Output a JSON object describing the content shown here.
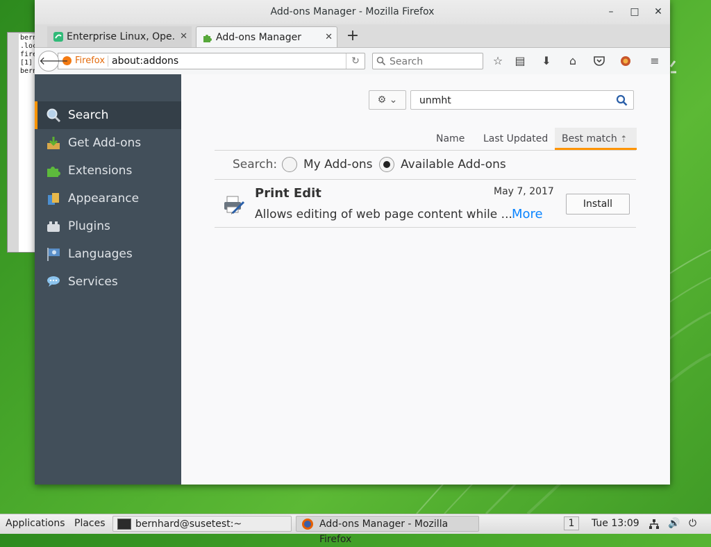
{
  "window": {
    "title": "Add-ons Manager - Mozilla Firefox",
    "minimize": "–",
    "maximize": "□",
    "close": "✕"
  },
  "background_terminal": {
    "lines": [
      "bern",
      ".loc",
      "fire",
      "[1]",
      "bern"
    ]
  },
  "tabs": [
    {
      "label": "Enterprise Linux, Ope...",
      "close": "✕"
    },
    {
      "label": "Add-ons Manager",
      "close": "✕"
    }
  ],
  "newtab": "+",
  "navbar": {
    "identity_label": "Firefox",
    "url": "about:addons",
    "search_placeholder": "Search"
  },
  "sidebar": {
    "items": [
      {
        "label": "Search"
      },
      {
        "label": "Get Add-ons"
      },
      {
        "label": "Extensions"
      },
      {
        "label": "Appearance"
      },
      {
        "label": "Plugins"
      },
      {
        "label": "Languages"
      },
      {
        "label": "Services"
      }
    ]
  },
  "addons_search": {
    "value": "unmht"
  },
  "sorters": {
    "name": "Name",
    "last_updated": "Last Updated",
    "best_match": "Best match"
  },
  "scope": {
    "label": "Search:",
    "my_addons": "My Add-ons",
    "available_addons": "Available Add-ons",
    "selected": "Available Add-ons"
  },
  "results": [
    {
      "name": "Print Edit",
      "date": "May 7, 2017",
      "description": "Allows editing of web page content while ...",
      "more": "More",
      "install": "Install"
    }
  ],
  "taskbar": {
    "applications": "Applications",
    "places": "Places",
    "terminal_task": "bernhard@susetest:~",
    "firefox_task": "Add-ons Manager - Mozilla Firefox",
    "workspace": "1",
    "clock": "Tue 13:09"
  },
  "colors": {
    "accent": "#ff9400",
    "sidebar_bg": "#424f5a",
    "link": "#0a84ff",
    "desktop": "#49a82b"
  }
}
